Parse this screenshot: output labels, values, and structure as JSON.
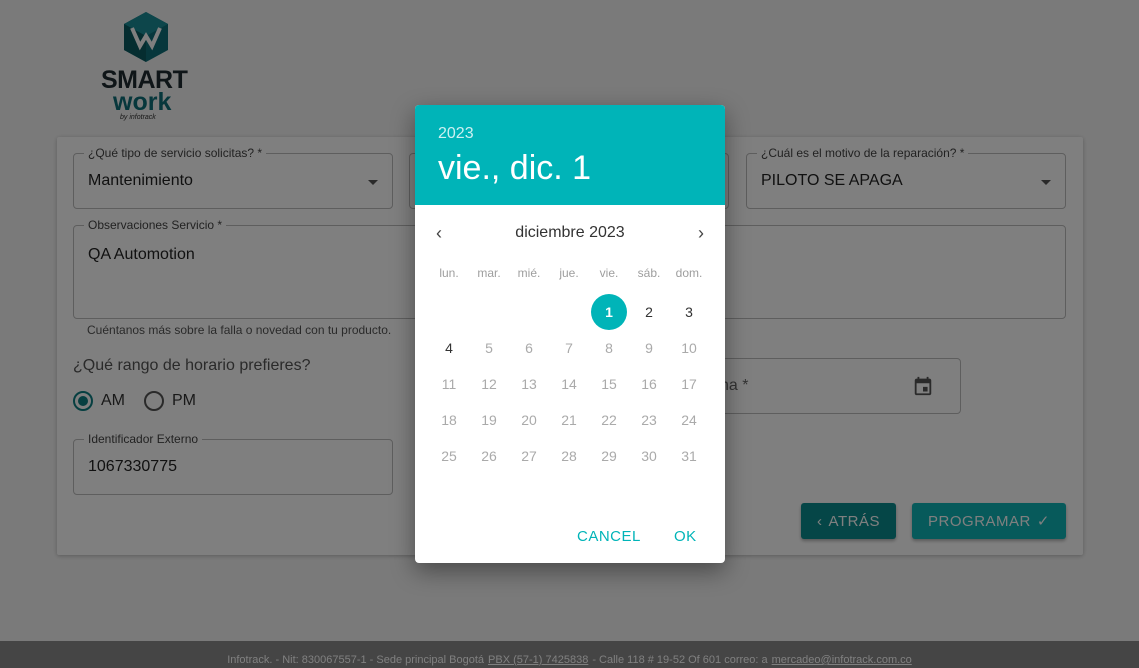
{
  "logo": {
    "line1": "SMART",
    "line2": "work",
    "line3": "by infotrack"
  },
  "form": {
    "service_type": {
      "label": "¿Qué tipo de servicio solicitas? *",
      "value": "Mantenimiento"
    },
    "repair_reason": {
      "label": "¿Cuál es el motivo de la reparación? *",
      "value": "PILOTO SE APAGA"
    },
    "observations": {
      "label": "Observaciones Servicio *",
      "value": "QA Automotion",
      "helper": "Cuéntanos más sobre la falla o novedad con tu producto."
    },
    "schedule_question": "¿Qué rango de horario prefieres?",
    "radio_am": "AM",
    "radio_pm": "PM",
    "date_field": {
      "label": "ha *"
    },
    "external_id": {
      "label": "Identificador Externo",
      "value": "1067330775"
    },
    "back_button": "ATRÁS",
    "program_button": "PROGRAMAR"
  },
  "footer": {
    "text1": "Infotrack. - Nit: 830067557-1 - Sede principal Bogotá",
    "phone": "PBX (57-1) 7425838",
    "text2": "- Calle 118 # 19-52 Of 601   correo: a",
    "email": "mercadeo@infotrack.com.co"
  },
  "datepicker": {
    "year": "2023",
    "selected_date": "vie., dic. 1",
    "month_title": "diciembre 2023",
    "weekdays": [
      "lun.",
      "mar.",
      "mié.",
      "jue.",
      "vie.",
      "sáb.",
      "dom."
    ],
    "selected_day": 1,
    "enabled_days": [
      1,
      2,
      3,
      4
    ],
    "first_weekday_index": 4,
    "days_in_month": 31,
    "cancel": "CANCEL",
    "ok": "OK"
  }
}
